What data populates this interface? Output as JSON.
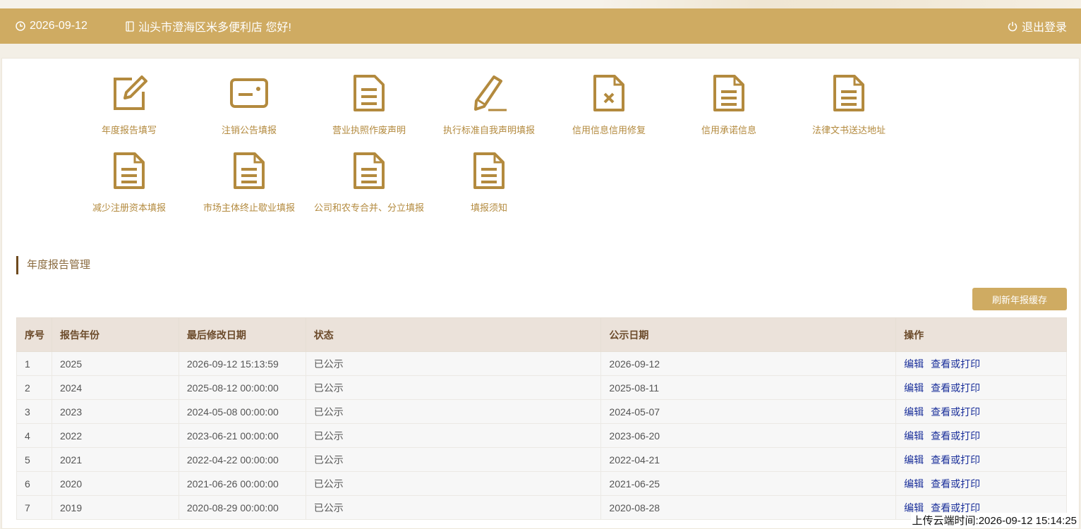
{
  "header": {
    "date": "2026-09-12",
    "greeting": "汕头市澄海区米多便利店 您好!",
    "logout": "退出登录",
    "bg_color": "#cfab62"
  },
  "tiles": [
    {
      "label": "年度报告填写",
      "icon": "edit-icon"
    },
    {
      "label": "注销公告填报",
      "icon": "card-icon"
    },
    {
      "label": "营业执照作废声明",
      "icon": "document-icon"
    },
    {
      "label": "执行标准自我声明填报",
      "icon": "pencil-icon"
    },
    {
      "label": "信用信息信用修复",
      "icon": "document-x-icon"
    },
    {
      "label": "信用承诺信息",
      "icon": "document-icon"
    },
    {
      "label": "法律文书送达地址",
      "icon": "document-icon"
    },
    {
      "label": "减少注册资本填报",
      "icon": "document-icon"
    },
    {
      "label": "市场主体终止歇业填报",
      "icon": "document-icon"
    },
    {
      "label": "公司和农专合并、分立填报",
      "icon": "document-icon"
    },
    {
      "label": "填报须知",
      "icon": "document-icon"
    }
  ],
  "section": {
    "title": "年度报告管理",
    "refresh_button": "刷新年报缓存"
  },
  "table": {
    "columns": [
      "序号",
      "报告年份",
      "最后修改日期",
      "状态",
      "公示日期",
      "操作"
    ],
    "rows": [
      {
        "no": "1",
        "year": "2025",
        "modified": "2026-09-12 15:13:59",
        "status": "已公示",
        "publish": "2026-09-12",
        "edit": "编辑",
        "view": "查看或打印"
      },
      {
        "no": "2",
        "year": "2024",
        "modified": "2025-08-12 00:00:00",
        "status": "已公示",
        "publish": "2025-08-11",
        "edit": "编辑",
        "view": "查看或打印"
      },
      {
        "no": "3",
        "year": "2023",
        "modified": "2024-05-08 00:00:00",
        "status": "已公示",
        "publish": "2024-05-07",
        "edit": "编辑",
        "view": "查看或打印"
      },
      {
        "no": "4",
        "year": "2022",
        "modified": "2023-06-21 00:00:00",
        "status": "已公示",
        "publish": "2023-06-20",
        "edit": "编辑",
        "view": "查看或打印"
      },
      {
        "no": "5",
        "year": "2021",
        "modified": "2022-04-22 00:00:00",
        "status": "已公示",
        "publish": "2022-04-21",
        "edit": "编辑",
        "view": "查看或打印"
      },
      {
        "no": "6",
        "year": "2020",
        "modified": "2021-06-26 00:00:00",
        "status": "已公示",
        "publish": "2021-06-25",
        "edit": "编辑",
        "view": "查看或打印"
      },
      {
        "no": "7",
        "year": "2019",
        "modified": "2020-08-29 00:00:00",
        "status": "已公示",
        "publish": "2020-08-28",
        "edit": "编辑",
        "view": "查看或打印"
      }
    ]
  },
  "footer": {
    "upload_time": "上传云端时间:2026-09-12 15:14:25"
  }
}
